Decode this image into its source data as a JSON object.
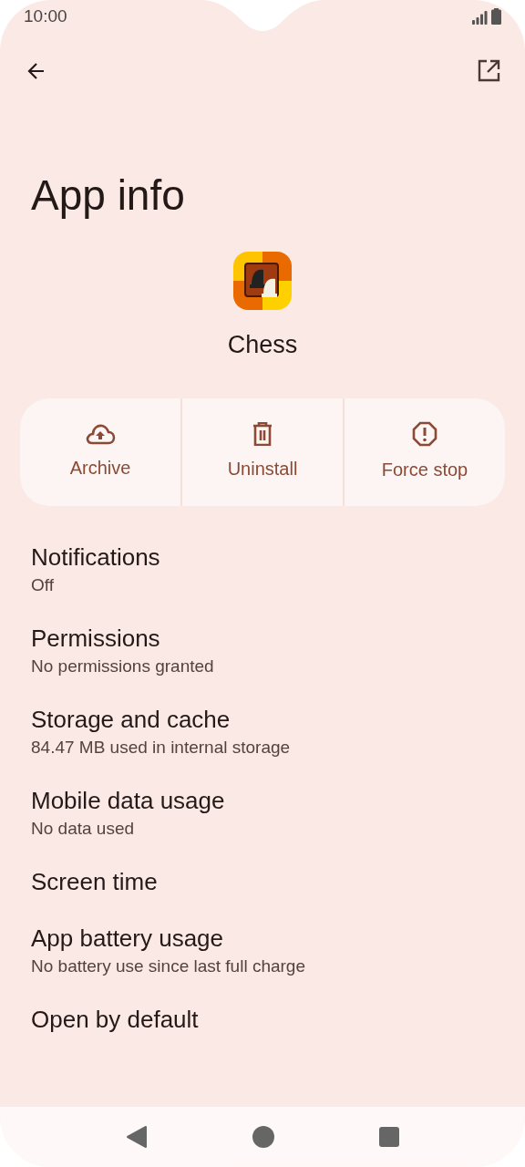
{
  "status_bar": {
    "time": "10:00"
  },
  "title": "App info",
  "app": {
    "name": "Chess"
  },
  "actions": [
    {
      "kind": "archive",
      "label": "Archive"
    },
    {
      "kind": "uninstall",
      "label": "Uninstall"
    },
    {
      "kind": "force_stop",
      "label": "Force stop"
    }
  ],
  "settings": [
    {
      "title": "Notifications",
      "summary": "Off"
    },
    {
      "title": "Permissions",
      "summary": "No permissions granted"
    },
    {
      "title": "Storage and cache",
      "summary": "84.47 MB used in internal storage"
    },
    {
      "title": "Mobile data usage",
      "summary": "No data used"
    },
    {
      "title": "Screen time"
    },
    {
      "title": "App battery usage",
      "summary": "No battery use since last full charge"
    },
    {
      "title": "Open by default"
    }
  ]
}
